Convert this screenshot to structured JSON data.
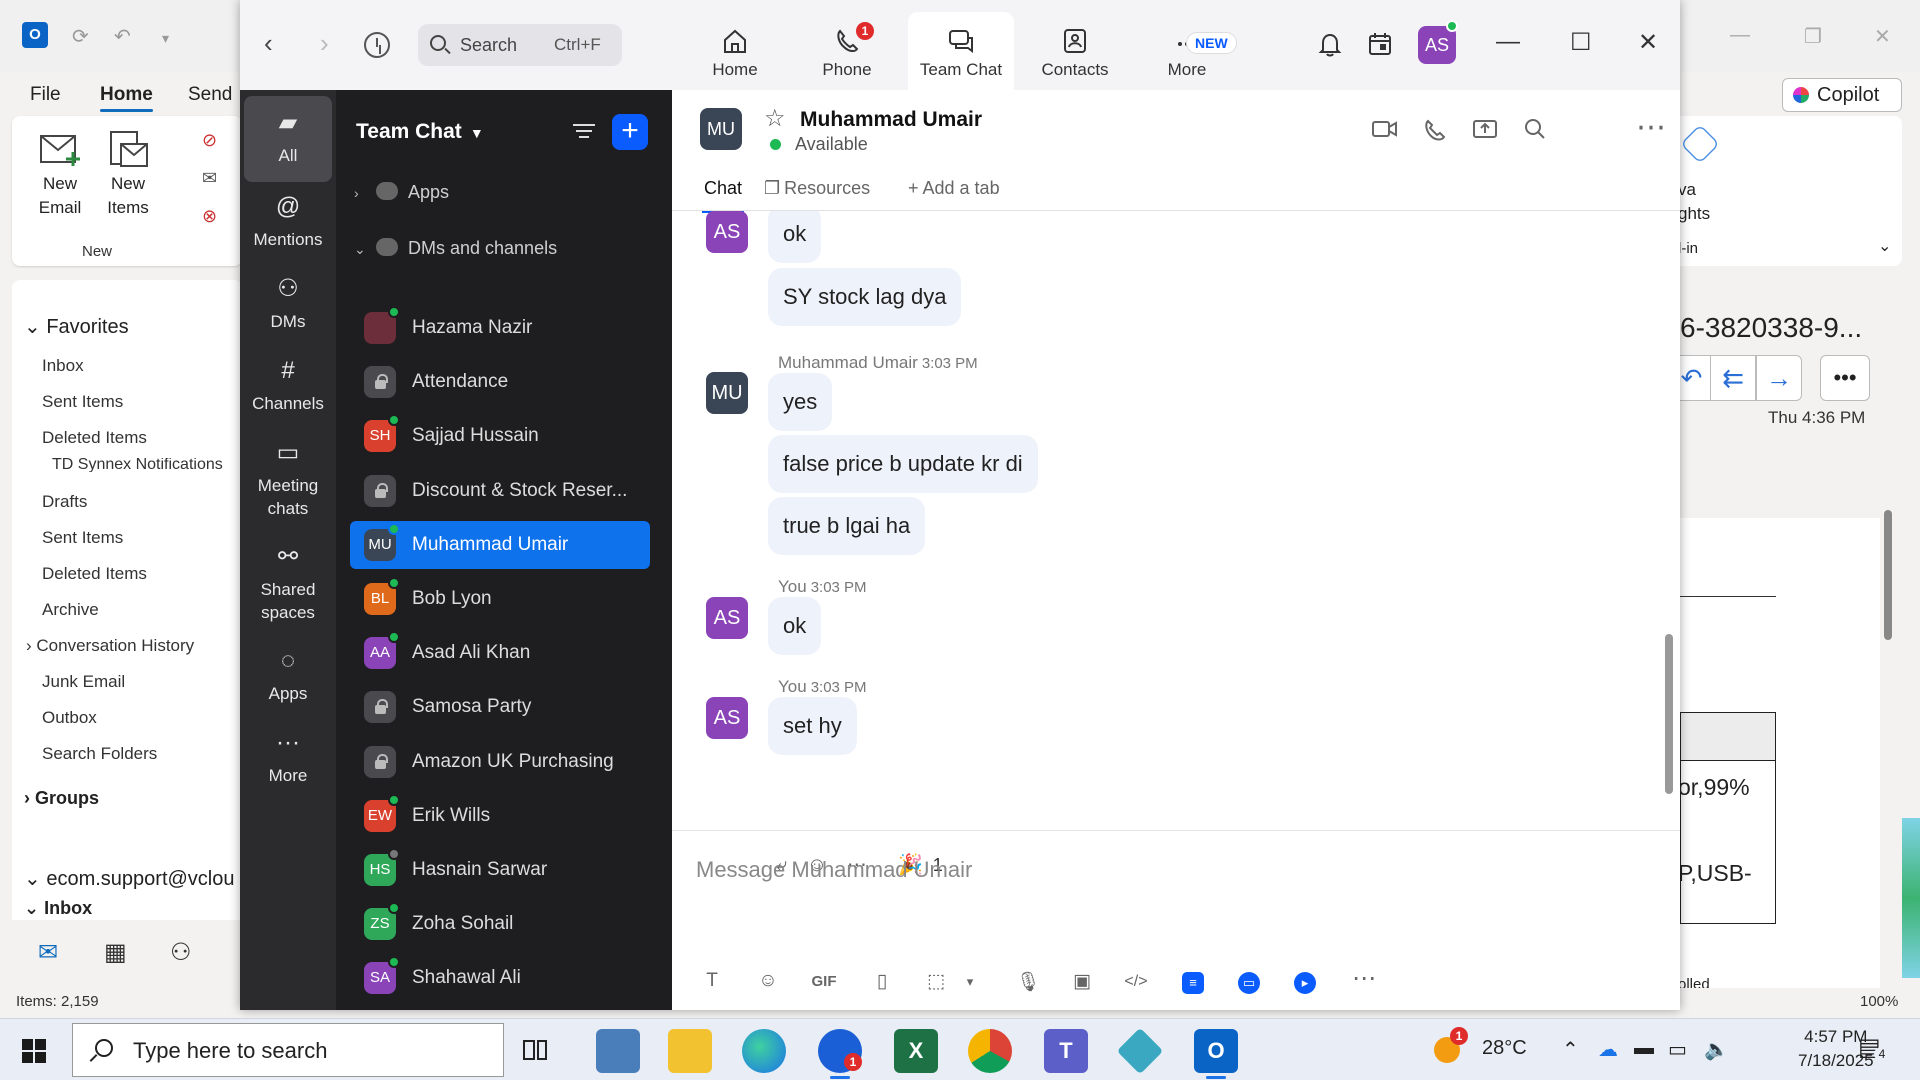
{
  "outlook": {
    "menu": [
      "File",
      "Home",
      "Send"
    ],
    "ribbon": {
      "new_email_l1": "New",
      "new_email_l2": "Email",
      "new_items_l1": "New",
      "new_items_l2": "Items",
      "group_new": "New"
    },
    "folders": {
      "favorites": "Favorites",
      "fav_items": [
        "Inbox",
        "Sent Items",
        "Deleted Items",
        "TD Synnex Notifications"
      ],
      "mail_items": [
        "Drafts",
        "Sent Items",
        "Deleted Items",
        "Archive",
        "Conversation History",
        "Junk Email",
        "Outbox",
        "Search Folders"
      ],
      "groups": "Groups",
      "account": "ecom.support@vclou",
      "inbox": "Inbox"
    },
    "status_items": "Items: 2,159",
    "copilot": "Copilot",
    "ribbon_right_l1": "va",
    "ribbon_right_l2": "ghts",
    "ribbon_right_l3": "l-in",
    "subject": "6-3820338-9...",
    "date": "Thu 4:36 PM",
    "doc_text_1": "or,99%",
    "doc_text_2": "P,USB-",
    "doc_text_3": "olled",
    "zoom": "100%"
  },
  "zoom_app": {
    "search": {
      "label": "Search",
      "shortcut": "Ctrl+F"
    },
    "tabs": [
      {
        "label": "Home",
        "icon": "home-icon"
      },
      {
        "label": "Phone",
        "icon": "phone-icon",
        "badge": "1"
      },
      {
        "label": "Team Chat",
        "icon": "chat-icon"
      },
      {
        "label": "Contacts",
        "icon": "contacts-icon"
      },
      {
        "label": "More",
        "icon": "more-icon",
        "badge_new": "NEW"
      }
    ],
    "avatar": "AS",
    "rail": [
      {
        "label": "All"
      },
      {
        "label": "Mentions"
      },
      {
        "label": "DMs"
      },
      {
        "label": "Channels"
      },
      {
        "label1": "Meeting",
        "label2": "chats"
      },
      {
        "label1": "Shared",
        "label2": "spaces"
      },
      {
        "label": "Apps"
      },
      {
        "label": "More"
      }
    ],
    "chatlist": {
      "title": "Team Chat",
      "apps": "Apps",
      "dms": "DMs and channels",
      "items": [
        {
          "name": "Hazama Nazir",
          "initials": "",
          "color": "#6b2e3a",
          "status": "online"
        },
        {
          "name": "Attendance",
          "initials": "",
          "lock": true
        },
        {
          "name": "Sajjad Hussain",
          "initials": "SH",
          "color": "#d9412e",
          "status": "online"
        },
        {
          "name": "Discount & Stock Reser...",
          "initials": "",
          "lock": true
        },
        {
          "name": "Muhammad Umair",
          "initials": "MU",
          "color": "#3a4656",
          "status": "online",
          "selected": true
        },
        {
          "name": "Bob Lyon",
          "initials": "BL",
          "color": "#e06a1c",
          "status": "online"
        },
        {
          "name": "Asad Ali Khan",
          "initials": "AA",
          "color": "#8b44b8",
          "status": "online"
        },
        {
          "name": "Samosa Party",
          "initials": "",
          "lock": true
        },
        {
          "name": "Amazon UK Purchasing",
          "initials": "",
          "lock": true
        },
        {
          "name": "Erik Wills",
          "initials": "EW",
          "color": "#d9412e",
          "status": "online"
        },
        {
          "name": "Hasnain Sarwar",
          "initials": "HS",
          "color": "#2fa85a",
          "status": "away"
        },
        {
          "name": "Zoha Sohail",
          "initials": "ZS",
          "color": "#2fa85a",
          "status": "online"
        },
        {
          "name": "Shahawal Ali",
          "initials": "SA",
          "color": "#8b44b8",
          "status": "online"
        }
      ]
    },
    "chat": {
      "contact": "Muhammad Umair",
      "initials": "MU",
      "status": "Available",
      "tabs": [
        "Chat",
        "Resources",
        "Add a tab"
      ],
      "my_initials": "AS",
      "messages": [
        {
          "text": "ok"
        },
        {
          "text": "SY stock lag dya"
        },
        {
          "author": "Muhammad Umair",
          "time": "3:03 PM"
        },
        {
          "text": "yes"
        },
        {
          "text": "false price b update kr di"
        },
        {
          "text": "true b lgai ha"
        },
        {
          "author": "You",
          "time": "3:03 PM"
        },
        {
          "text": "ok"
        },
        {
          "author": "You",
          "time": "3:03 PM"
        },
        {
          "text": "set hy"
        }
      ],
      "reaction_count": "1",
      "composer_placeholder": "Message Muhammad Umair"
    }
  },
  "taskbar": {
    "search_placeholder": "Type here to search",
    "weather": "28°C",
    "weather_badge": "1",
    "time": "4:57 PM",
    "date": "7/18/2025",
    "notifications": "4"
  }
}
